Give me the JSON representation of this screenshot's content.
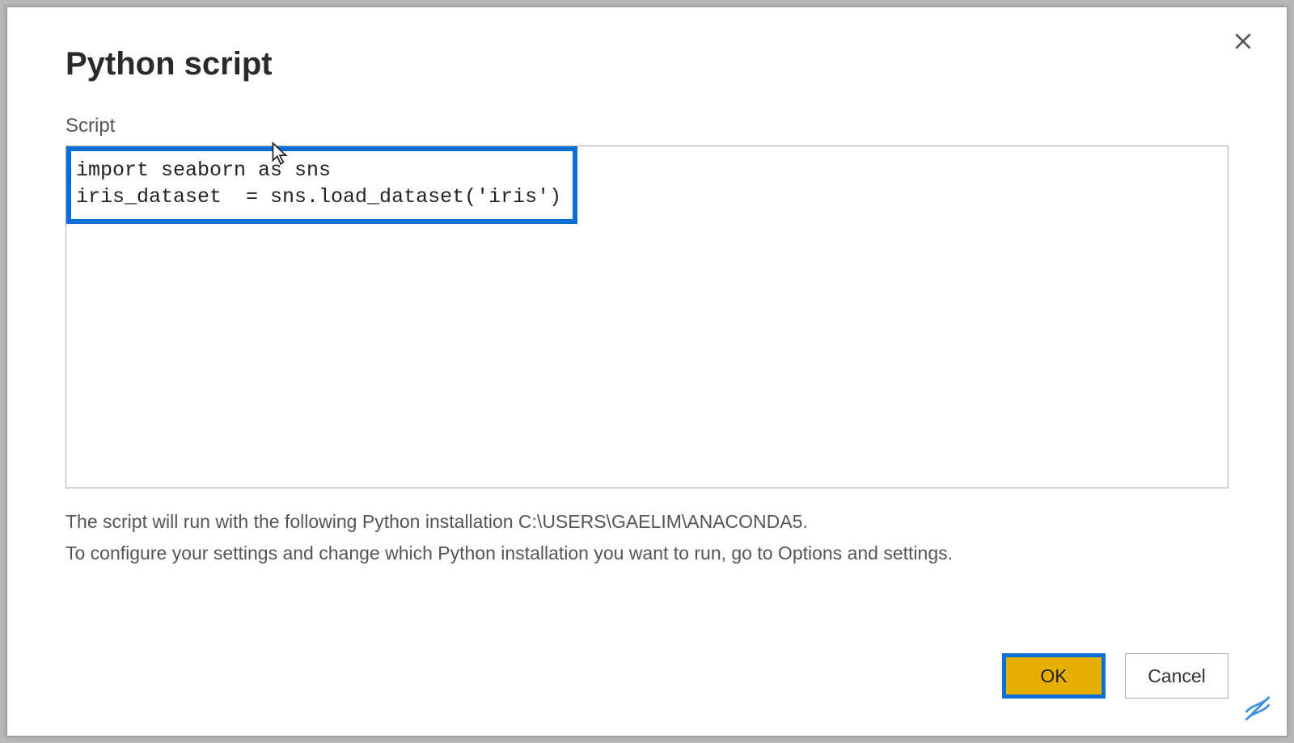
{
  "dialog": {
    "title": "Python script",
    "field_label": "Script",
    "script_value": "import seaborn as sns\niris_dataset  = sns.load_dataset('iris')",
    "info_line1": "The script will run with the following Python installation C:\\USERS\\GAELIM\\ANACONDA5.",
    "info_line2": "To configure your settings and change which Python installation you want to run, go to Options and settings.",
    "buttons": {
      "ok": "OK",
      "cancel": "Cancel"
    }
  }
}
